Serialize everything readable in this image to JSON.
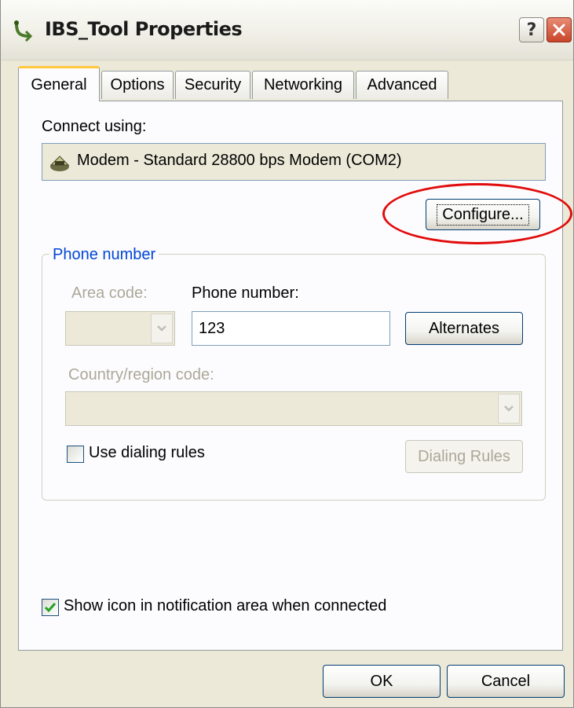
{
  "window": {
    "title": "IBS_Tool Properties"
  },
  "tabs": [
    {
      "label": "General",
      "active": true
    },
    {
      "label": "Options",
      "active": false
    },
    {
      "label": "Security",
      "active": false
    },
    {
      "label": "Networking",
      "active": false
    },
    {
      "label": "Advanced",
      "active": false
    }
  ],
  "connect": {
    "label": "Connect using:",
    "device": "Modem - Standard 28800 bps Modem (COM2)",
    "configure_button": "Configure..."
  },
  "phone": {
    "group_label": "Phone number",
    "area_code_label": "Area code:",
    "area_code_value": "",
    "phone_label": "Phone number:",
    "phone_value": "123",
    "alternates_button": "Alternates",
    "country_label": "Country/region code:",
    "country_value": "",
    "dialing_rules_checkbox": "Use dialing rules",
    "dialing_rules_checked": false,
    "dialing_rules_button": "Dialing Rules"
  },
  "notification": {
    "label": "Show icon in notification area when connected",
    "checked": true
  },
  "footer": {
    "ok_button": "OK",
    "cancel_button": "Cancel"
  },
  "colors": {
    "highlight_ellipse": "#e20b0b",
    "active_tab_accent": "#ffc83c",
    "group_label": "#0046d5",
    "dialog_face": "#ece9d8"
  },
  "icons": {
    "title": "network-connection-icon",
    "device": "modem-icon",
    "help": "help-icon",
    "close": "close-icon",
    "dropdown": "chevron-down-icon",
    "check": "checkmark-icon"
  }
}
